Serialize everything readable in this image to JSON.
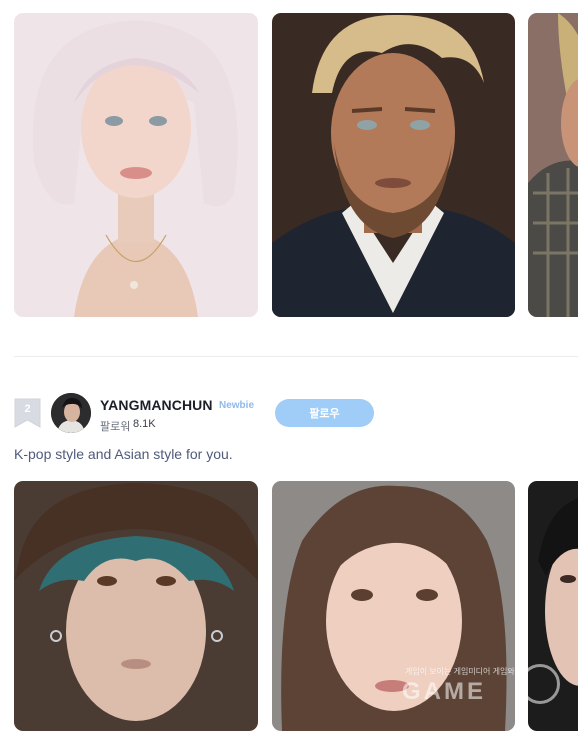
{
  "top_row": {
    "images": [
      {
        "subject": "avatar with short platinum bob hair and necklace"
      },
      {
        "subject": "avatar of a blond bearded man in a dark blazer"
      },
      {
        "subject": "partially visible avatar in a plaid jacket"
      }
    ]
  },
  "creator": {
    "rank": "2",
    "username": "YANGMANCHUN",
    "level_badge": "Newbie",
    "follower_label": "팔로워",
    "follower_count": "8.1K",
    "follow_button": "팔로우",
    "description": "K-pop style and Asian style for you."
  },
  "bottom_row": {
    "images": [
      {
        "subject": "avatar with teal hair, dark cap and earrings"
      },
      {
        "subject": "avatar with long brown hair"
      },
      {
        "subject": "partially visible avatar with dark hair"
      }
    ]
  },
  "watermark": {
    "subtitle": "게임이 보이는 게임미디어 게임와이",
    "logo": "GAME"
  },
  "colors": {
    "follow_button_bg": "#9fcdf7",
    "level_badge": "#8fb9ec",
    "description_text": "#4f5b7a",
    "username": "#1c1f2a"
  }
}
